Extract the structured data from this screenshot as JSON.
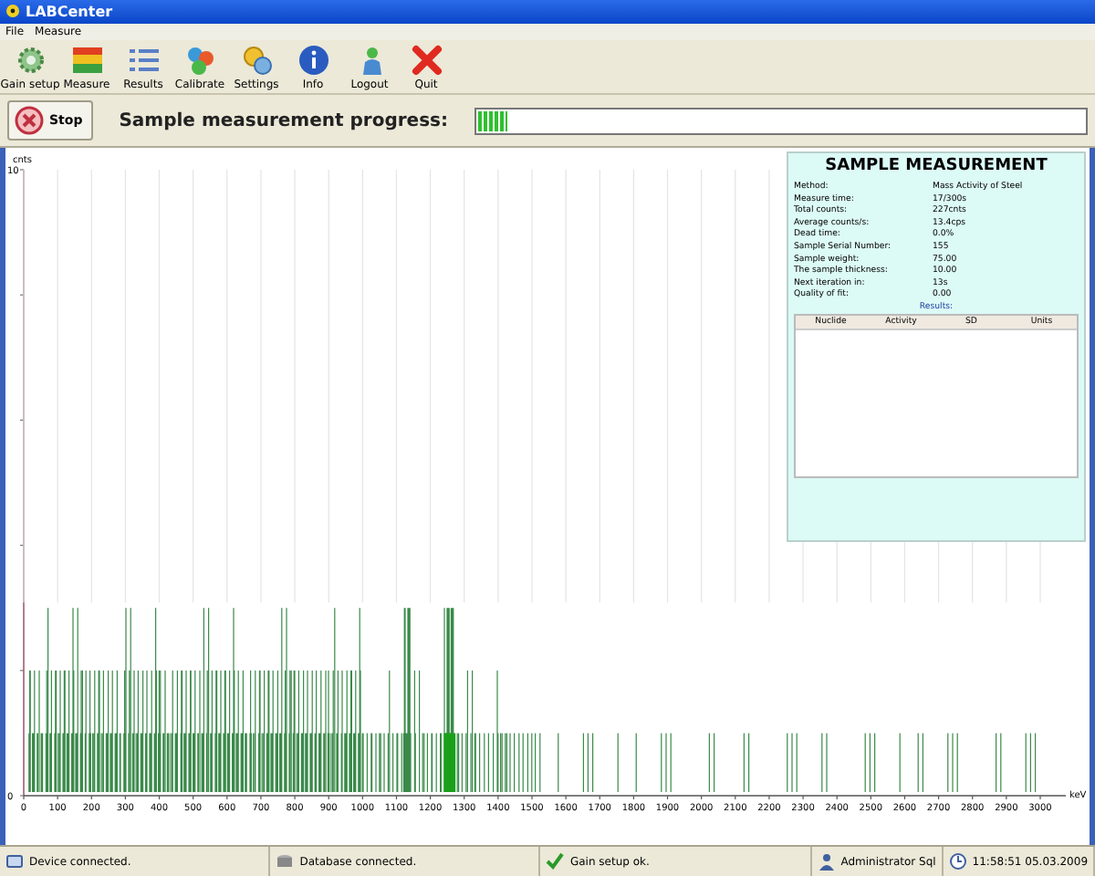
{
  "window": {
    "title": "LABCenter"
  },
  "menu": [
    "File",
    "Measure"
  ],
  "toolbar": [
    {
      "label": "Gain setup",
      "kind": "gain"
    },
    {
      "label": "Measure",
      "kind": "measure"
    },
    {
      "label": "Results",
      "kind": "results"
    },
    {
      "label": "Calibrate",
      "kind": "calibrate"
    },
    {
      "label": "Settings",
      "kind": "settings"
    },
    {
      "label": "Info",
      "kind": "info"
    },
    {
      "label": "Logout",
      "kind": "logout"
    },
    {
      "label": "Quit",
      "kind": "quit"
    }
  ],
  "stop_button": {
    "label": "Stop"
  },
  "progress": {
    "label": "Sample measurement progress:",
    "level": 0.05
  },
  "chart": {
    "y_axis": {
      "label": "cnts",
      "ticks": [
        "10",
        "0"
      ]
    },
    "x_axis": {
      "unit": "keV",
      "ticks": [
        "0",
        "100",
        "200",
        "300",
        "400",
        "500",
        "600",
        "700",
        "800",
        "900",
        "1000",
        "1100",
        "1200",
        "1300",
        "1400",
        "1500",
        "1600",
        "1700",
        "1800",
        "1900",
        "2000",
        "2100",
        "2200",
        "2300",
        "2400",
        "2500",
        "2600",
        "2700",
        "2800",
        "2900",
        "3000"
      ]
    }
  },
  "panel": {
    "title": "SAMPLE MEASUREMENT",
    "fields": [
      {
        "label": "Method:",
        "value": "Mass Activity of Steel"
      },
      {
        "label": "Measure time:",
        "value": "17/300s"
      },
      {
        "label": "Total counts:",
        "value": "227cnts"
      },
      {
        "label": "Average counts/s:",
        "value": "13.4cps"
      },
      {
        "label": "Dead time:",
        "value": "0.0%"
      },
      {
        "label": "Sample Serial Number:",
        "value": "155"
      },
      {
        "label": "Sample weight:",
        "value": "75.00"
      },
      {
        "label": "The sample thickness:",
        "value": "10.00"
      },
      {
        "label": "Next iteration in:",
        "value": "13s"
      },
      {
        "label": "Quality of fit:",
        "value": "0.00"
      }
    ],
    "results_label": "Results:",
    "columns": [
      "Nuclide",
      "Activity",
      "SD",
      "Units"
    ]
  },
  "status_bar": [
    {
      "text": "Device connected.",
      "kind": "device"
    },
    {
      "text": "Database connected.",
      "kind": "database"
    },
    {
      "text": "Gain setup ok.",
      "kind": "check"
    },
    {
      "text": "Administrator Sql",
      "kind": "user"
    },
    {
      "text": "11:58:51 05.03.2009",
      "kind": "clock"
    }
  ]
}
